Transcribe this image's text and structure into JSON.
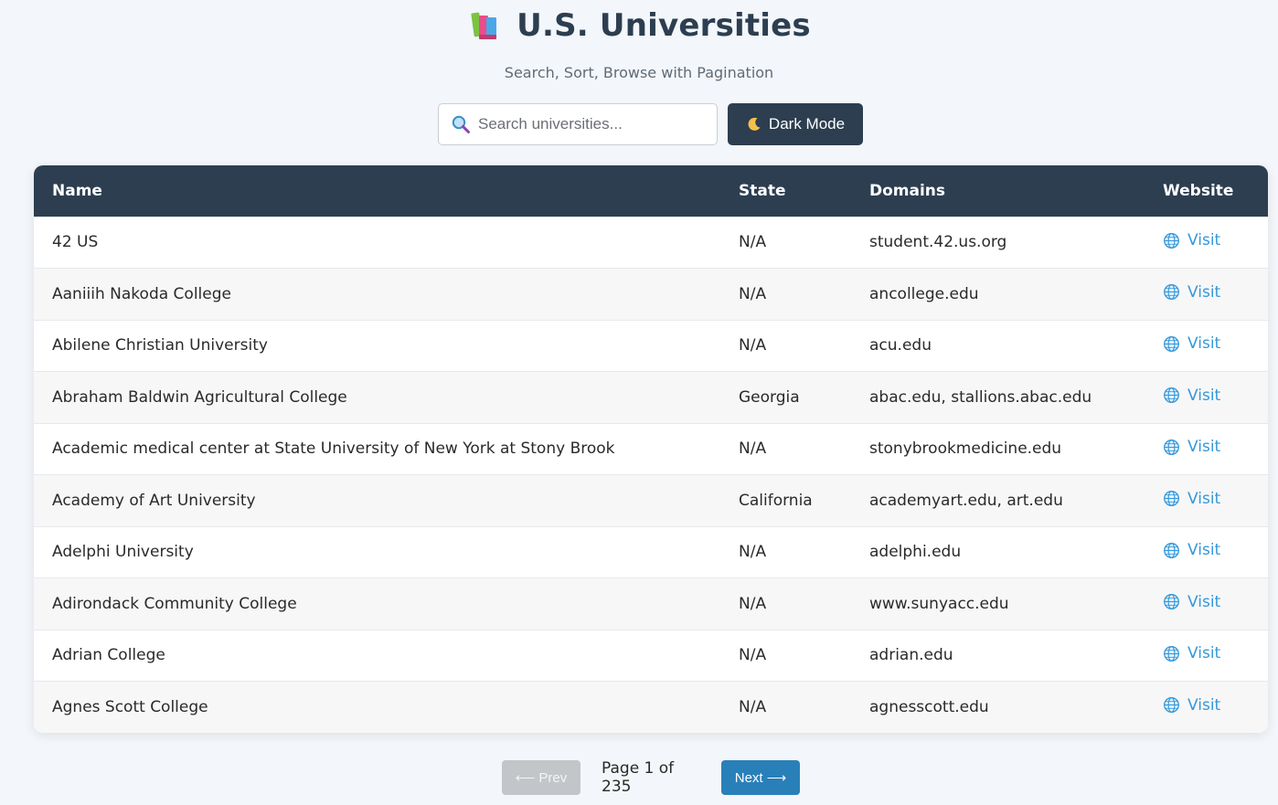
{
  "header": {
    "title": "U.S. Universities",
    "subtitle": "Search, Sort, Browse with Pagination",
    "icon": "books-icon"
  },
  "controls": {
    "search_placeholder": "Search universities...",
    "search_value": "",
    "dark_mode_label": "Dark Mode"
  },
  "table": {
    "columns": [
      "Name",
      "State",
      "Domains",
      "Website"
    ],
    "rows": [
      {
        "name": "42 US",
        "state": "N/A",
        "domains": "student.42.us.org",
        "website": "Visit"
      },
      {
        "name": "Aaniiih Nakoda College",
        "state": "N/A",
        "domains": "ancollege.edu",
        "website": "Visit"
      },
      {
        "name": "Abilene Christian University",
        "state": "N/A",
        "domains": "acu.edu",
        "website": "Visit"
      },
      {
        "name": "Abraham Baldwin Agricultural College",
        "state": "Georgia",
        "domains": "abac.edu, stallions.abac.edu",
        "website": "Visit"
      },
      {
        "name": "Academic medical center at State University of New York at Stony Brook",
        "state": "N/A",
        "domains": "stonybrookmedicine.edu",
        "website": "Visit"
      },
      {
        "name": "Academy of Art University",
        "state": "California",
        "domains": "academyart.edu, art.edu",
        "website": "Visit"
      },
      {
        "name": "Adelphi University",
        "state": "N/A",
        "domains": "adelphi.edu",
        "website": "Visit"
      },
      {
        "name": "Adirondack Community College",
        "state": "N/A",
        "domains": "www.sunyacc.edu",
        "website": "Visit"
      },
      {
        "name": "Adrian College",
        "state": "N/A",
        "domains": "adrian.edu",
        "website": "Visit"
      },
      {
        "name": "Agnes Scott College",
        "state": "N/A",
        "domains": "agnesscott.edu",
        "website": "Visit"
      }
    ]
  },
  "pagination": {
    "prev_label": "⟵ Prev",
    "page_info": "Page 1 of 235",
    "next_label": "Next ⟶"
  },
  "colors": {
    "header_bg": "#2c3e50",
    "link": "#3498db",
    "next_button": "#2980b9",
    "prev_button_disabled": "#c3c6c9"
  }
}
